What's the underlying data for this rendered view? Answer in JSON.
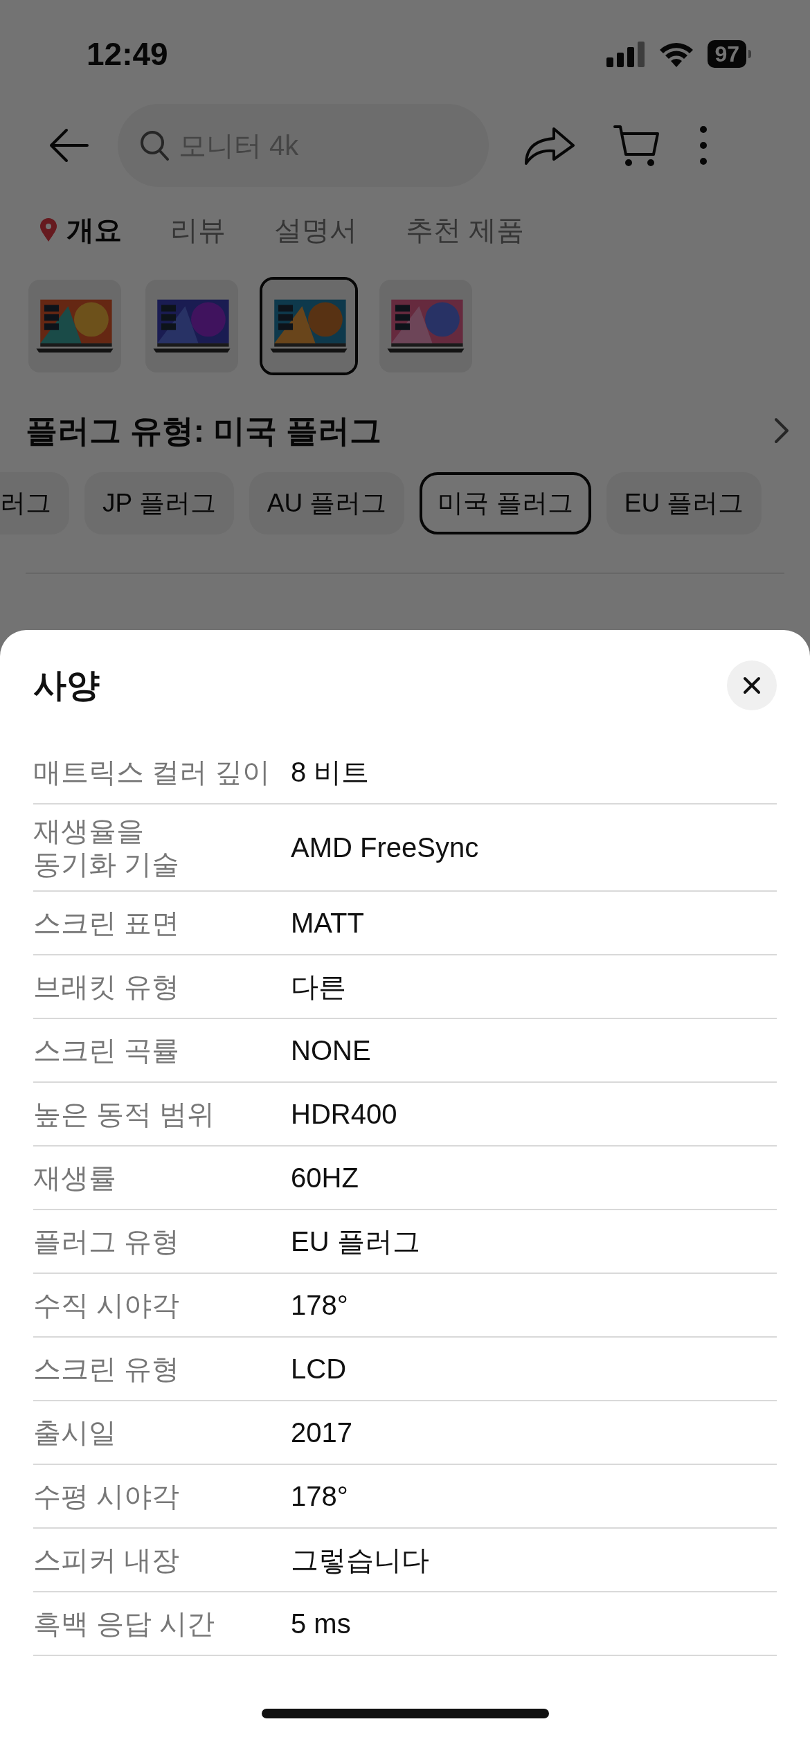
{
  "status_bar": {
    "time": "12:49",
    "battery": "97"
  },
  "search": {
    "placeholder": "모니터 4k"
  },
  "tabs": [
    {
      "label": "개요",
      "selected": true
    },
    {
      "label": "리뷰",
      "selected": false
    },
    {
      "label": "설명서",
      "selected": false
    },
    {
      "label": "추천 제품",
      "selected": false
    }
  ],
  "thumbnails": [
    {
      "kind": "picture",
      "selected": false
    },
    {
      "kind": "picture",
      "selected": false
    },
    {
      "kind": "picture",
      "selected": true
    },
    {
      "kind": "picture",
      "selected": false
    }
  ],
  "option_title": "플러그 유형: 미국 플러그",
  "options": [
    {
      "label": "러그",
      "selected": false
    },
    {
      "label": "JP 플러그",
      "selected": false
    },
    {
      "label": "AU 플러그",
      "selected": false
    },
    {
      "label": "미국 플러그",
      "selected": true
    },
    {
      "label": "EU 플러그",
      "selected": false
    }
  ],
  "sheet": {
    "title": "사양",
    "specs": [
      {
        "label": "매트릭스 컬러 깊이",
        "value": "8 비트"
      },
      {
        "label": "재생율을\n동기화 기술",
        "value": "AMD FreeSync"
      },
      {
        "label": "스크린 표면",
        "value": "MATT"
      },
      {
        "label": "브래킷 유형",
        "value": "다른"
      },
      {
        "label": "스크린 곡률",
        "value": "NONE"
      },
      {
        "label": "높은 동적 범위",
        "value": "HDR400"
      },
      {
        "label": "재생률",
        "value": "60HZ"
      },
      {
        "label": "플러그 유형",
        "value": "EU 플러그"
      },
      {
        "label": "수직 시야각",
        "value": "178°"
      },
      {
        "label": "스크린 유형",
        "value": "LCD"
      },
      {
        "label": "출시일",
        "value": "2017"
      },
      {
        "label": "수평 시야각",
        "value": "178°"
      },
      {
        "label": "스피커 내장",
        "value": "그렇습니다"
      },
      {
        "label": "흑백 응답 시간",
        "value": "5 ms"
      }
    ]
  }
}
